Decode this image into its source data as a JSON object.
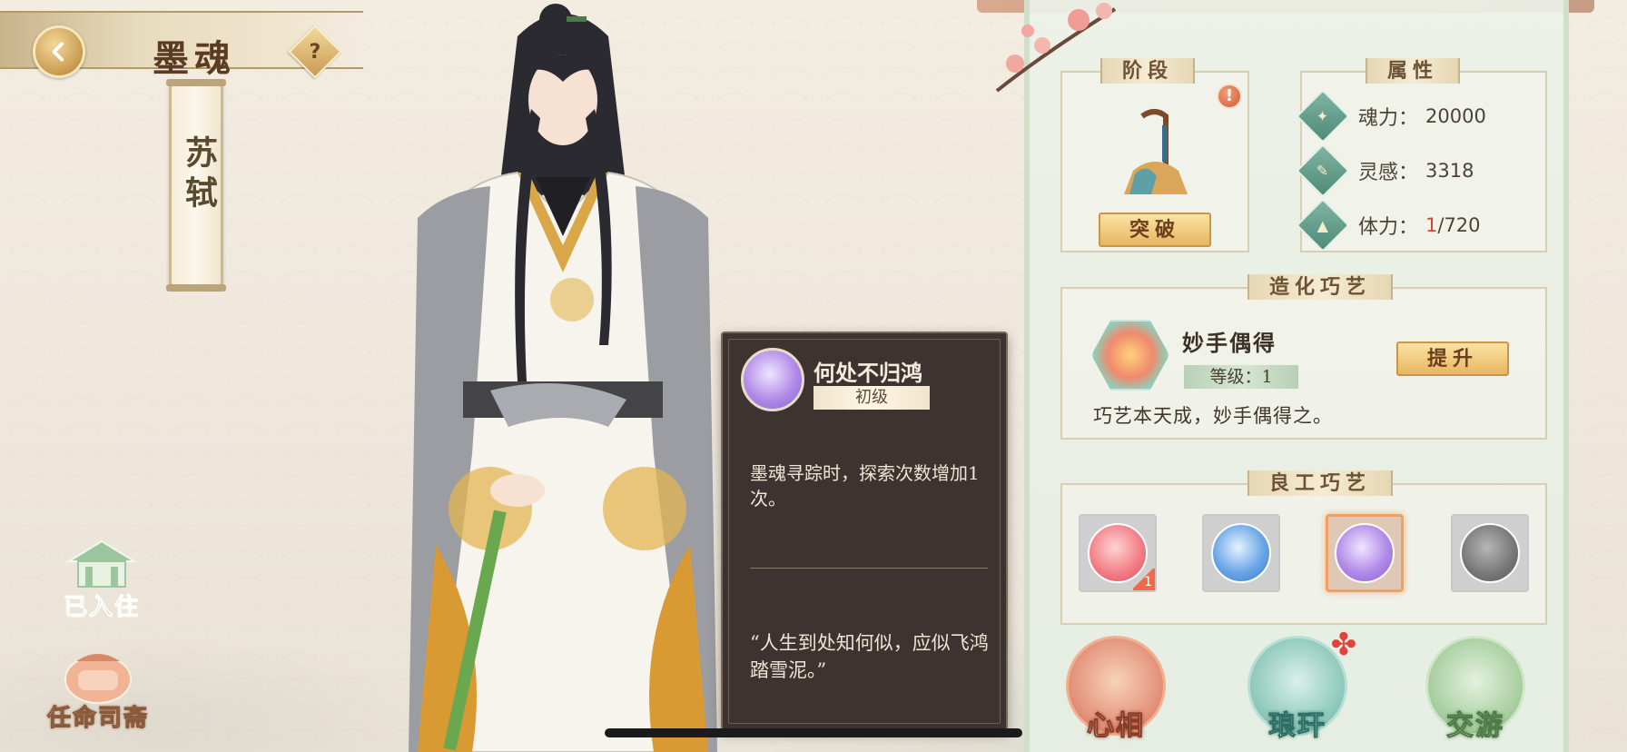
{
  "header": {
    "title": "墨魂",
    "back_icon": "back-arrow-icon",
    "help_label": "?"
  },
  "character": {
    "name": "苏轼"
  },
  "left_buttons": {
    "residence_label": "已入住",
    "appoint_label": "任命司斋"
  },
  "tooltip": {
    "skill_name": "何处不归鸿",
    "grade": "初级",
    "description": "墨魂寻踪时，探索次数增加1次。",
    "quote": "“人生到处知何似，应似飞鸿踏雪泥。”"
  },
  "stage": {
    "header": "阶段",
    "alert": "!",
    "breakthrough_label": "突破"
  },
  "attributes": {
    "header": "属性",
    "items": [
      {
        "label": "魂力：",
        "value": "20000",
        "icon": "soul-power-icon"
      },
      {
        "label": "灵感：",
        "value": "3318",
        "icon": "inspiration-icon"
      },
      {
        "label": "体力：",
        "value_current": "1",
        "value_max": "/720",
        "icon": "stamina-icon"
      }
    ]
  },
  "craft": {
    "header": "造化巧艺",
    "name": "妙手偶得",
    "level": "等级：1",
    "upgrade_label": "提升",
    "description": "巧艺本天成，妙手偶得之。"
  },
  "good_craft": {
    "header": "良工巧艺",
    "slots": [
      {
        "icon": "gift-jar-icon",
        "badge": "1"
      },
      {
        "icon": "blue-spirit-icon"
      },
      {
        "icon": "goose-icon",
        "selected": true
      },
      {
        "icon": "umbrella-clock-icon"
      }
    ]
  },
  "bottom_nav": {
    "heart_label": "心相",
    "langgan_label": "琅玕",
    "travel_label": "交游"
  },
  "colors": {
    "accent_gold": "#e7b662",
    "panel_green": "#cfe0c8",
    "tooltip_bg": "#3d3431",
    "alert_red": "#d05a32"
  }
}
